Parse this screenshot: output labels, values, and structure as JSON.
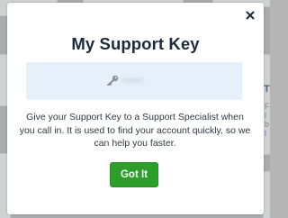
{
  "dialog": {
    "title": "My Support Key",
    "support_key": {
      "value": "••••••",
      "icon": "key-icon"
    },
    "description": "Give your Support Key to a Support Specialist when you call in. It is used to find your account quickly, so we can help you faster.",
    "confirm_label": "Got It",
    "close_icon": "close-icon"
  },
  "background": {
    "visible_heading_fragment": "T"
  },
  "colors": {
    "overlay": "#a9abad",
    "modal_bg": "#ffffff",
    "title": "#1c2b3a",
    "key_box_bg": "#e5f0fb",
    "button_bg": "#2e9e2b",
    "button_text": "#ffffff",
    "body_text": "#2f3943"
  }
}
